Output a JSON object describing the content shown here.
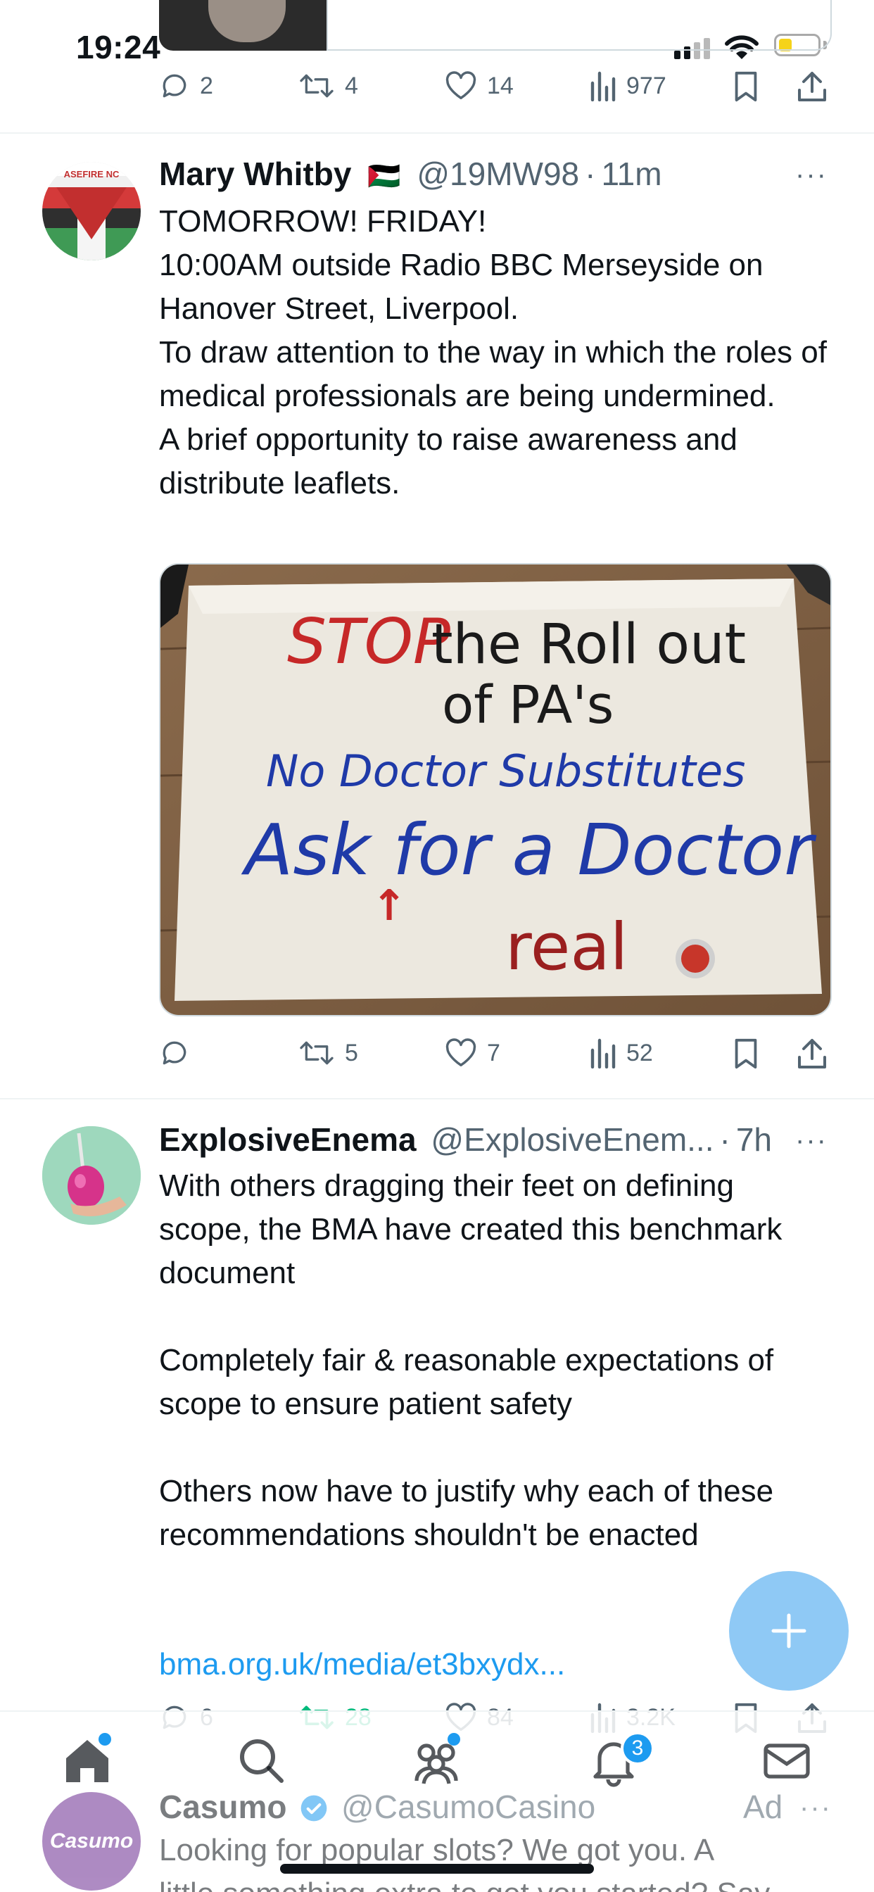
{
  "status_bar": {
    "time": "19:24"
  },
  "top_tweet": {
    "actions": {
      "replies": "2",
      "retweets": "4",
      "likes": "14",
      "views": "977"
    }
  },
  "tweet1": {
    "name": "Mary Whitby",
    "flag": "🇵🇸",
    "handle": "@19MW98",
    "separator": "·",
    "time": "11m",
    "more": "···",
    "text": "TOMORROW! FRIDAY!\n10:00AM outside Radio BBC Merseyside on Hanover Street, Liverpool.\nTo draw attention to the way in which the roles of medical professionals are being undermined.\nA brief opportunity to raise awareness and distribute leaflets.",
    "avatar_text": "ASEFIRE NC",
    "banner": {
      "line1_red": "STOP",
      "line1_black": "the Roll out",
      "line2": "of PA's",
      "line3": "No Doctor Substitutes",
      "line4": "Ask for a Doctor",
      "arrow": "↑",
      "line5": "real"
    },
    "actions": {
      "replies": "",
      "retweets": "5",
      "likes": "7",
      "views": "52"
    }
  },
  "tweet2": {
    "name": "ExplosiveEnema",
    "handle": "@ExplosiveEnem...",
    "separator": "·",
    "time": "7h",
    "more": "···",
    "text": "With others dragging their feet on defining scope, the BMA have created this benchmark document\n\nCompletely fair & reasonable expectations of scope to ensure patient safety\n\nOthers now have to justify why each of these recommendations shouldn't be enacted",
    "link": "bma.org.uk/media/et3bxydx...",
    "actions": {
      "replies": "6",
      "retweets": "28",
      "likes": "84",
      "views": "3.2K"
    }
  },
  "ad_tweet": {
    "name": "Casumo",
    "handle": "@CasumoCasino",
    "ad_label": "Ad",
    "more": "···",
    "avatar_text": "Casumo",
    "text_line1": "Looking for popular slots? We got you. A",
    "text_line2": "little something extra to get you started? Say"
  },
  "nav": {
    "notifications_badge": "3"
  },
  "colors": {
    "accent": "#1d9bf0",
    "retweet_active": "#00ba7c",
    "muted": "#536471"
  }
}
